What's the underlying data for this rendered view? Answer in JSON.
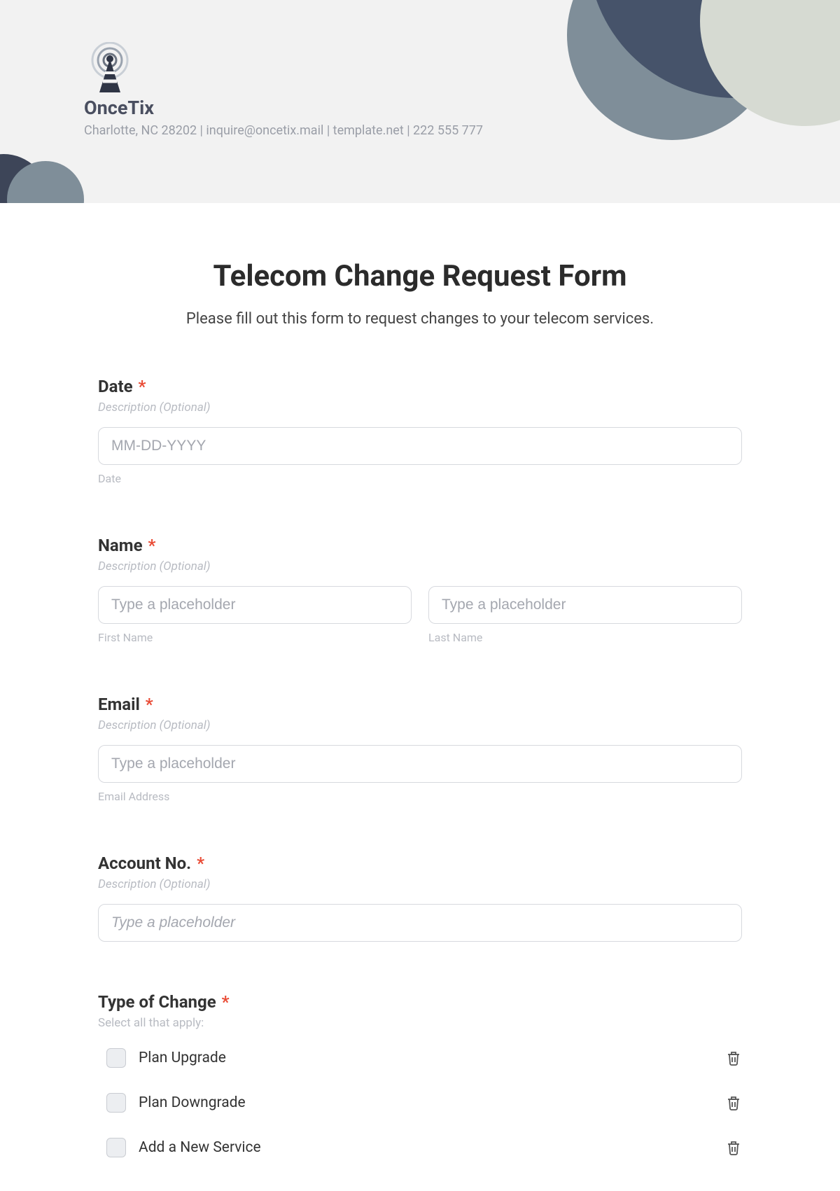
{
  "header": {
    "brand_name": "OnceTix",
    "meta": "Charlotte, NC 28202 | inquire@oncetix.mail | template.net | 222 555 777"
  },
  "form": {
    "title": "Telecom Change Request Form",
    "subtitle": "Please fill out this form to request changes to your telecom services.",
    "fields": {
      "date": {
        "label": "Date",
        "desc": "Description (Optional)",
        "placeholder": "MM-DD-YYYY",
        "sublabel": "Date"
      },
      "name": {
        "label": "Name",
        "desc": "Description (Optional)",
        "first_placeholder": "Type a placeholder",
        "first_sublabel": "First Name",
        "last_placeholder": "Type a placeholder",
        "last_sublabel": "Last Name"
      },
      "email": {
        "label": "Email",
        "desc": "Description (Optional)",
        "placeholder": "Type a placeholder",
        "sublabel": "Email Address"
      },
      "account": {
        "label": "Account No.",
        "desc": "Description (Optional)",
        "placeholder": "Type a placeholder"
      },
      "change_type": {
        "label": "Type of Change",
        "helper": "Select all that apply:",
        "options": [
          {
            "label": "Plan Upgrade"
          },
          {
            "label": "Plan Downgrade"
          },
          {
            "label": "Add a New Service"
          }
        ]
      }
    }
  }
}
